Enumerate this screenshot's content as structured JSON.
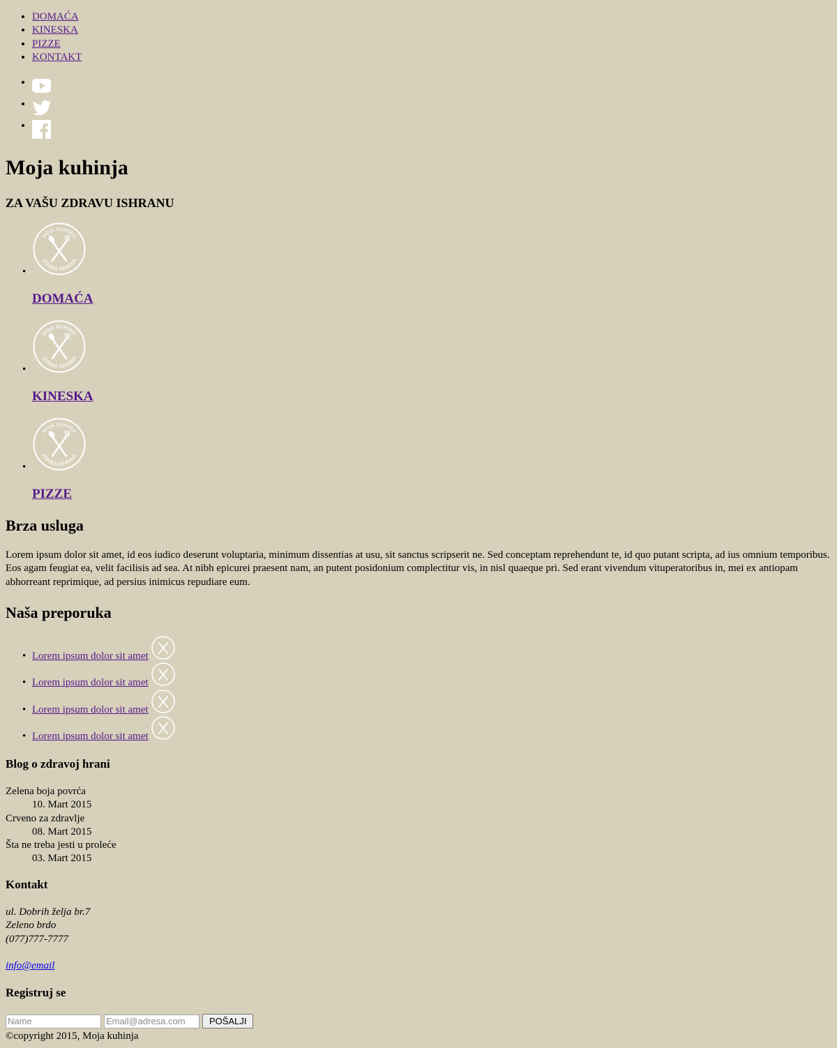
{
  "nav": {
    "items": [
      {
        "label": "DOMAĆA"
      },
      {
        "label": "KINESKA"
      },
      {
        "label": "PIZZE"
      },
      {
        "label": "KONTAKT"
      }
    ]
  },
  "social": {
    "icons": [
      "youtube-icon",
      "twitter-icon",
      "facebook-icon"
    ]
  },
  "header": {
    "title": "Moja kuhinja",
    "tagline": "ZA VAŠU ZDRAVU ISHRANU"
  },
  "categories": [
    {
      "title": "DOMAĆA",
      "logo_text_top": "MOJA KUHINJA",
      "logo_text_bottom": "ZDRAVA ISHRANA"
    },
    {
      "title": "KINESKA",
      "logo_text_top": "MOJA KUHINJA",
      "logo_text_bottom": "ZDRAVA ISHRANA"
    },
    {
      "title": "PIZZE",
      "logo_text_top": "MOJA KUHINJA",
      "logo_text_bottom": "ZDRAVA ISHRANA"
    }
  ],
  "brza": {
    "title": "Brza usluga",
    "text": "Lorem ipsum dolor sit amet, id eos iudico deserunt voluptaria, minimum dissentias at usu, sit sanctus scripserit ne. Sed conceptam reprehendunt te, id quo putant scripta, ad ius omnium temporibus. Eos agam feugiat ea, velit facilisis ad sea. At nibh epicurei praesent nam, an putent posidonium complectitur vis, in nisl quaeque pri. Sed erant vivendum vituperatoribus in, mei ex antiopam abhorreant reprimique, ad persius inimicus repudiare eum."
  },
  "preporuka": {
    "title": "Naša preporuka",
    "items": [
      {
        "label": "Lorem ipsum dolor sit amet"
      },
      {
        "label": "Lorem ipsum dolor sit amet"
      },
      {
        "label": "Lorem ipsum dolor sit amet"
      },
      {
        "label": "Lorem ipsum dolor sit amet"
      }
    ]
  },
  "blog": {
    "title": "Blog o zdravoj hrani",
    "posts": [
      {
        "title": "Zelena boja povrća",
        "date": "10. Mart 2015"
      },
      {
        "title": "Crveno za zdravlje",
        "date": "08. Mart 2015"
      },
      {
        "title": "Šta ne treba jesti u proleće",
        "date": "03. Mart 2015"
      }
    ]
  },
  "kontakt": {
    "title": "Kontakt",
    "street": "ul. Dobrih želja br.7",
    "city": "Zeleno brdo",
    "phone": "(077)777-7777",
    "email": "info@email"
  },
  "register": {
    "title": "Registruj se",
    "name_placeholder": "Name",
    "email_placeholder": "Email@adresa.com",
    "submit_label": "POŠALJI"
  },
  "footer": {
    "copyright": "©copyright 2015, Moja kuhinja"
  },
  "colors": {
    "background": "#d7d0bb",
    "link": "#551a8b",
    "mail_link": "#0000ee",
    "icon": "#ffffff"
  }
}
